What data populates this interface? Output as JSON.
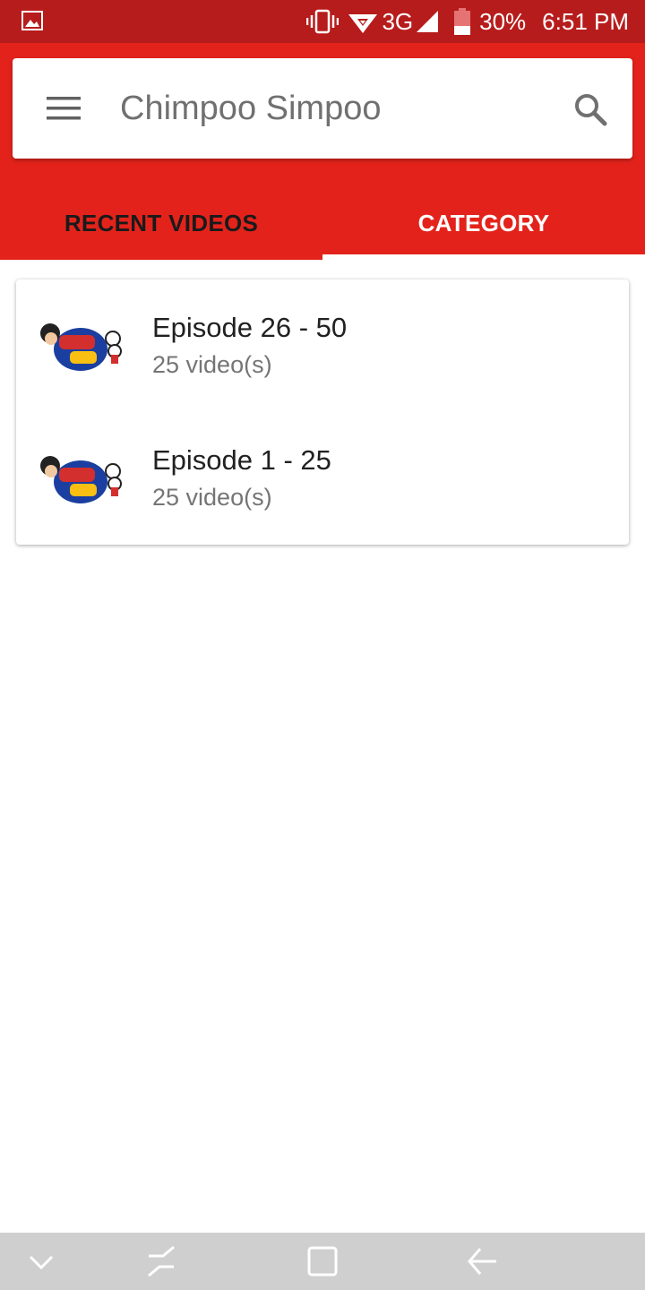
{
  "status_bar": {
    "network": "3G",
    "battery": "30%",
    "time": "6:51 PM",
    "icons": [
      "gallery-icon",
      "vibrate-icon",
      "wifi-icon",
      "signal-icon",
      "battery-icon"
    ]
  },
  "header": {
    "app_title": "Chimpoo Simpoo",
    "menu_icon": "menu-icon",
    "search_icon": "search-icon"
  },
  "tabs": [
    {
      "label": "RECENT VIDEOS",
      "active": false
    },
    {
      "label": "CATEGORY",
      "active": true
    }
  ],
  "categories": [
    {
      "title": "Episode 26 - 50",
      "count": "25 video(s)",
      "thumbnail": "chimpoo-simpoo-logo"
    },
    {
      "title": "Episode 1 - 25",
      "count": "25 video(s)",
      "thumbnail": "chimpoo-simpoo-logo"
    }
  ],
  "nav_bar": {
    "buttons": [
      "collapse-icon",
      "recent-apps-icon",
      "home-icon",
      "back-icon"
    ]
  },
  "colors": {
    "primary": "#e3231b",
    "status_bar": "#b71c1c",
    "tab_indicator": "#ffffff",
    "nav_bar": "#cfcfcf"
  }
}
